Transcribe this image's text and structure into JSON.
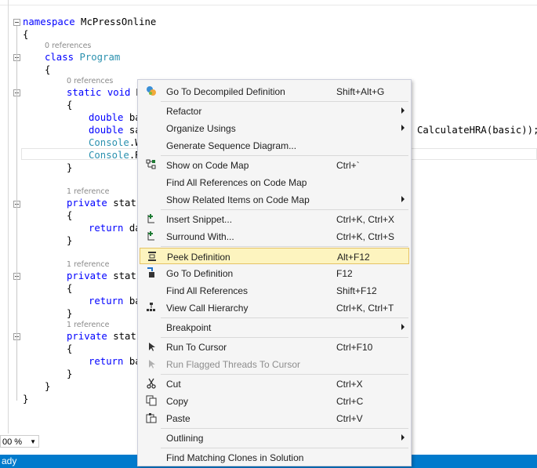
{
  "code": {
    "l1": {
      "kw": "namespace",
      "rest": " McPressOnline"
    },
    "l2": "{",
    "ref_program": "0 references",
    "l3": {
      "kw": "class",
      "type": "Program"
    },
    "l4": "{",
    "ref_main": "0 references",
    "l5": {
      "kw": "static void",
      "rest": " M"
    },
    "l6": "{",
    "l7": {
      "kw": "double",
      "rest": " ba"
    },
    "l8": {
      "kw": "double",
      "rest": " sa"
    },
    "l8_tail": "CalculateHRA(basic));",
    "l9": {
      "type": "Console",
      "rest": ".W"
    },
    "l10": {
      "type": "Console",
      "rest": ".R"
    },
    "l11": "}",
    "ref_1": "1 reference",
    "l12": {
      "kw": "private",
      "rest": " stati"
    },
    "l13": "{",
    "l14": {
      "kw": "return",
      "rest": " da"
    },
    "l15": "}",
    "ref_2": "1 reference",
    "l16": {
      "kw": "private",
      "rest": " stati"
    },
    "l17": "{",
    "l18": {
      "kw": "return",
      "rest": " ba"
    },
    "l19": "}",
    "ref_3": "1 reference",
    "l20": {
      "kw": "private",
      "rest": " stati"
    },
    "l21": "{",
    "l22": {
      "kw": "return",
      "rest": " ba"
    },
    "l23": "}",
    "l24": "}",
    "l25": "}"
  },
  "zoom": {
    "value": "00 %"
  },
  "status": {
    "text": "ady"
  },
  "menu": {
    "items": [
      {
        "label": "Go To Decompiled Definition",
        "shortcut": "Shift+Alt+G",
        "icon": "decompile-icon"
      },
      {
        "label": "Refactor",
        "shortcut": ""
      },
      {
        "label": "Organize Usings",
        "shortcut": ""
      },
      {
        "label": "Generate Sequence Diagram...",
        "shortcut": ""
      },
      {
        "label": "Show on Code Map",
        "shortcut": "Ctrl+`",
        "icon": "code-map-icon"
      },
      {
        "label": "Find All References on Code Map",
        "shortcut": ""
      },
      {
        "label": "Show Related Items on Code Map",
        "shortcut": ""
      },
      {
        "label": "Insert Snippet...",
        "shortcut": "Ctrl+K, Ctrl+X",
        "icon": "insert-snippet-icon"
      },
      {
        "label": "Surround With...",
        "shortcut": "Ctrl+K, Ctrl+S",
        "icon": "surround-with-icon"
      },
      {
        "label": "Peek Definition",
        "shortcut": "Alt+F12",
        "icon": "peek-definition-icon"
      },
      {
        "label": "Go To Definition",
        "shortcut": "F12",
        "icon": "go-to-definition-icon"
      },
      {
        "label": "Find All References",
        "shortcut": "Shift+F12"
      },
      {
        "label": "View Call Hierarchy",
        "shortcut": "Ctrl+K, Ctrl+T",
        "icon": "call-hierarchy-icon"
      },
      {
        "label": "Breakpoint",
        "shortcut": ""
      },
      {
        "label": "Run To Cursor",
        "shortcut": "Ctrl+F10",
        "icon": "run-to-cursor-icon"
      },
      {
        "label": "Run Flagged Threads To Cursor",
        "shortcut": "",
        "icon": "run-flagged-threads-icon"
      },
      {
        "label": "Cut",
        "shortcut": "Ctrl+X",
        "icon": "cut-icon"
      },
      {
        "label": "Copy",
        "shortcut": "Ctrl+C",
        "icon": "copy-icon"
      },
      {
        "label": "Paste",
        "shortcut": "Ctrl+V",
        "icon": "paste-icon"
      },
      {
        "label": "Outlining",
        "shortcut": ""
      },
      {
        "label": "Find Matching Clones in Solution",
        "shortcut": ""
      }
    ]
  },
  "colors": {
    "keyword": "#0000ff",
    "type": "#2b91af",
    "highlight": "#fdf4bf",
    "status_bar": "#007acc"
  }
}
